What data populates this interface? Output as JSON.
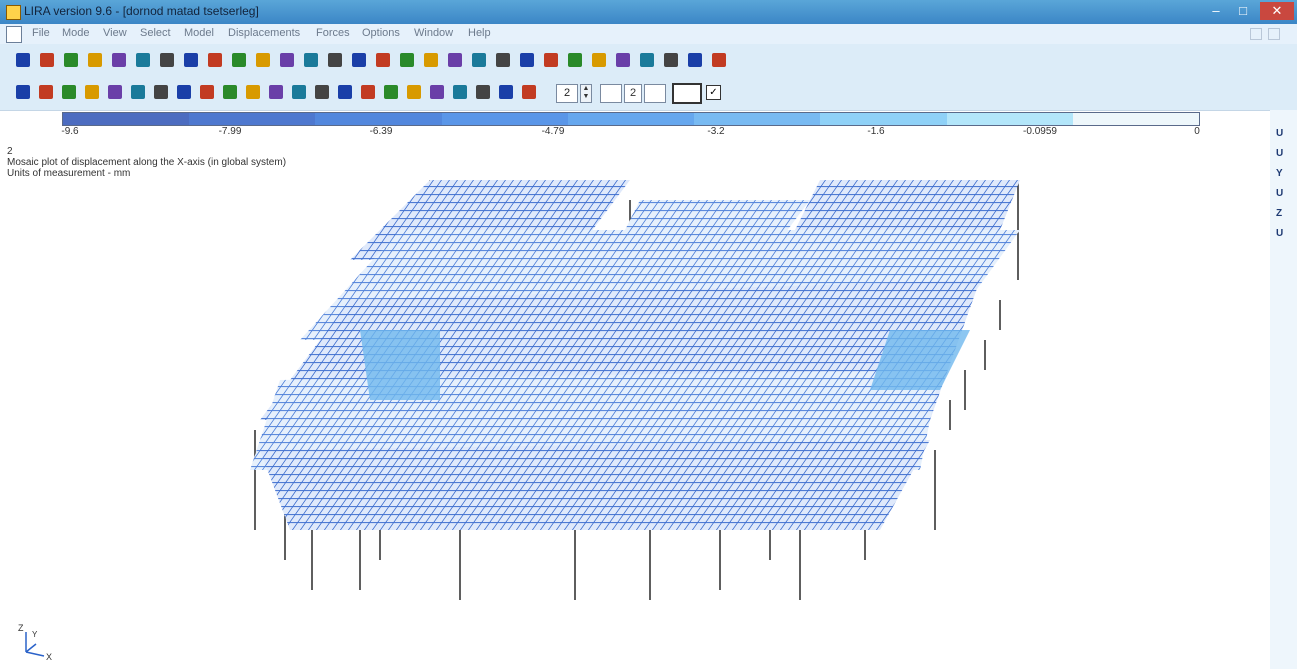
{
  "window": {
    "title": "LIRA  version 9.6  - [dornod matad tsetserleg]",
    "buttons": {
      "minimize": "–",
      "maximize": "□",
      "close": "✕"
    }
  },
  "menu": {
    "items": [
      "File",
      "Mode",
      "View",
      "Select",
      "Model",
      "Displacements",
      "Forces",
      "Options",
      "Window",
      "Help"
    ]
  },
  "toolbar1": {
    "icons": [
      "open-model-icon",
      "save-model-icon",
      "copy-icon",
      "load-case-icon",
      "load-case-2-icon",
      "load-case-3-icon",
      "axes-icon",
      "diagram-icon",
      "mosaic-icon",
      "isofield-icon",
      "rotate-icon",
      "pan-icon",
      "pencil-icon",
      "zoom-in-icon",
      "zoom-out-icon",
      "filter-icon",
      "fragment-icon",
      "view-front-icon",
      "view-side-icon",
      "view-top-icon",
      "lock-icon",
      "tools-icon",
      "person-icon",
      "calc-icon",
      "edit-icon",
      "flag-icon",
      "settings-icon",
      "whats-this-icon",
      "book-icon",
      "help-icon"
    ]
  },
  "toolbar2": {
    "icons": [
      "frame-a-icon",
      "frame-b-icon",
      "beam-icon",
      "node-a-icon",
      "node-b-icon",
      "load-icon",
      "arrow-tool-icon",
      "refresh-icon",
      "grid-a-icon",
      "grid-b-icon",
      "grid-c-icon",
      "grid-d-icon",
      "grid-e-icon",
      "grid-f-icon",
      "grid-g-icon",
      "grid-h-icon",
      "grid-i-icon",
      "grid-j-icon",
      "grid-k-icon",
      "grid-l-icon",
      "grid-m-icon",
      "grid-n-icon",
      "palette-icon"
    ],
    "spin_value": "2",
    "spin_value_2": "2",
    "check": "✓"
  },
  "colors": {
    "scale": [
      "#4c6cc0",
      "#4e78cf",
      "#5287dd",
      "#5a96e8",
      "#66a7ee",
      "#78baf2",
      "#8fd1f7",
      "#b3e6fa",
      "#eef7fb"
    ],
    "mesh_main": "#3f6fcf",
    "mesh_light": "#6fb8ee",
    "column": "#1a1a1a",
    "titlebar": "#4a98d0"
  },
  "legend": {
    "labels": [
      "-9.6",
      "-7.99",
      "-6.39",
      "-4.79",
      "-3.2",
      "-1.6",
      "-0.0959",
      "0"
    ]
  },
  "info": {
    "line1": "2",
    "line2": "Mosaic plot of displacement along the X-axis (in global system)",
    "line3": "Units of measurement - mm"
  },
  "side": {
    "labels": [
      "U",
      "U",
      "Y",
      "U",
      "Z",
      "U"
    ]
  },
  "axes": {
    "z": "Z",
    "y": "Y",
    "x": "X"
  }
}
